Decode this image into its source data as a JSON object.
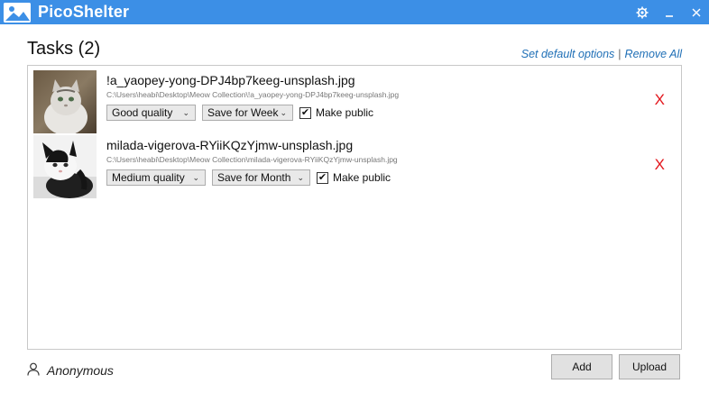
{
  "app": {
    "title": "PicoShelter",
    "brand_color": "#3c8fe6"
  },
  "header": {
    "tasks_title": "Tasks (2)",
    "set_default_options": "Set default options",
    "separator": "|",
    "remove_all": "Remove All"
  },
  "tasks": [
    {
      "file_name": "!a_yaopey-yong-DPJ4bp7keeg-unsplash.jpg",
      "file_path": "C:\\Users\\heabi\\Desktop\\Meow Collection\\!a_yaopey-yong-DPJ4bp7keeg-unsplash.jpg",
      "quality": "Good quality",
      "save_for": "Save for Week",
      "make_public_label": "Make public",
      "make_public_checked": true,
      "remove": "X"
    },
    {
      "file_name": "milada-vigerova-RYiiKQzYjmw-unsplash.jpg",
      "file_path": "C:\\Users\\heabi\\Desktop\\Meow Collection\\milada-vigerova-RYiiKQzYjmw-unsplash.jpg",
      "quality": "Medium quality",
      "save_for": "Save for Month",
      "make_public_label": "Make public",
      "make_public_checked": true,
      "remove": "X"
    }
  ],
  "footer": {
    "user": "Anonymous",
    "add_button": "Add",
    "upload_button": "Upload"
  },
  "icons": {
    "settings": "gear-icon",
    "minimize": "minimize-icon",
    "close": "close-icon",
    "user": "user-icon",
    "chevron": "chevron-down-icon",
    "check": "✔"
  }
}
